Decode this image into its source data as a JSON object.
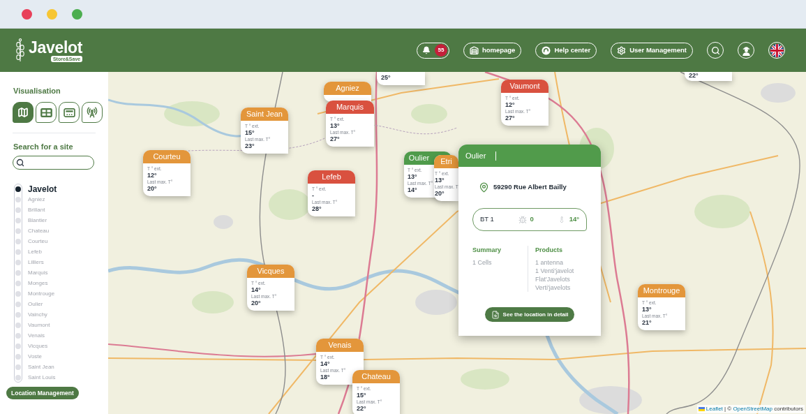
{
  "header": {
    "logo": {
      "name": "Javelot",
      "tagline": "Store&Save"
    },
    "notifications": {
      "count": "55"
    },
    "nav": [
      {
        "kind": "home",
        "label": "homepage"
      },
      {
        "kind": "help",
        "label": "Help center"
      },
      {
        "kind": "settings",
        "label": "User Management"
      }
    ],
    "tools": [
      {
        "kind": "search"
      },
      {
        "kind": "profile"
      },
      {
        "kind": "language"
      }
    ]
  },
  "sidebar": {
    "visualisation": {
      "title": "Visualisation",
      "views": [
        {
          "kind": "map",
          "selected": true
        },
        {
          "kind": "table",
          "selected": false
        },
        {
          "kind": "dashboard",
          "selected": false
        },
        {
          "kind": "antenna",
          "selected": false
        }
      ]
    },
    "search": {
      "title": "Search for a site"
    },
    "sites": [
      {
        "name": "Javelot",
        "selected": true
      },
      {
        "name": "Agniez",
        "selected": false
      },
      {
        "name": "Brillant",
        "selected": false
      },
      {
        "name": "Blantier",
        "selected": false
      },
      {
        "name": "Chateau",
        "selected": false
      },
      {
        "name": "Courteu",
        "selected": false
      },
      {
        "name": "Lefeb",
        "selected": false
      },
      {
        "name": "Lilliers",
        "selected": false
      },
      {
        "name": "Marquis",
        "selected": false
      },
      {
        "name": "Monges",
        "selected": false
      },
      {
        "name": "Montrouge",
        "selected": false
      },
      {
        "name": "Oulier",
        "selected": false
      },
      {
        "name": "Vainchy",
        "selected": false
      },
      {
        "name": "Vaumont",
        "selected": false
      },
      {
        "name": "Venais",
        "selected": false
      },
      {
        "name": "Vicques",
        "selected": false
      },
      {
        "name": "Voste",
        "selected": false
      },
      {
        "name": "Saint Jean",
        "selected": false
      },
      {
        "name": "Saint Louis",
        "selected": false
      }
    ],
    "action": "Location Management"
  },
  "map": {
    "markers": [
      {
        "max": "25°"
      },
      {
        "max": "22°"
      },
      {
        "name": "Agniez",
        "color": "#e3963b"
      },
      {
        "name": "Marquis",
        "color": "#d9513f",
        "ext_label": "T ° ext.",
        "ext": "13°",
        "max_label": "Last max. T°",
        "max": "27°"
      },
      {
        "name": "Saint Jean",
        "color": "#e3963b",
        "ext_label": "T ° ext.",
        "ext": "15°",
        "max_label": "Last max. T°",
        "max": "23°"
      },
      {
        "name": "Courteu",
        "color": "#e3963b",
        "ext_label": "T ° ext.",
        "ext": "12°",
        "max_label": "Last max. T°",
        "max": "20°"
      },
      {
        "name": "Lefeb",
        "color": "#d9513f",
        "ext_label": "T ° ext.",
        "ext": "-",
        "max_label": "Last max. T°",
        "max": "28°"
      },
      {
        "name": "Oulier",
        "color": "#4f9b4b",
        "ext_label": "T ° ext.",
        "ext": "13°",
        "max_label": "Last max. T°",
        "max": "14°"
      },
      {
        "name": "Etri",
        "color": "#e3963b",
        "ext_label": "T ° ext.",
        "ext": "13°",
        "max_label": "Last max. T",
        "max": "20°"
      },
      {
        "name": "Vaumont",
        "color": "#d9513f",
        "ext_label": "T ° ext.",
        "ext": "12°",
        "max_label": "Last max. T°",
        "max": "27°"
      },
      {
        "name": "Vicques",
        "color": "#e3963b",
        "ext_label": "T ° ext.",
        "ext": "14°",
        "max_label": "Last max. T°",
        "max": "20°"
      },
      {
        "name": "Venais",
        "color": "#e3963b",
        "ext_label": "T ° ext.",
        "ext": "14°",
        "max_label": "Last max. T°",
        "max": "18°"
      },
      {
        "name": "Chateau",
        "color": "#e3963b",
        "ext_label": "T ° ext.",
        "ext": "15°",
        "max_label": "Last max. T°",
        "max": "22°"
      },
      {
        "name": "Montrouge",
        "color": "#e3963b",
        "ext_label": "T ° ext.",
        "ext": "13°",
        "max_label": "Last max. T°",
        "max": "21°"
      }
    ],
    "popup": {
      "title": "Oulier",
      "address": "59290 Rue Albert Bailly",
      "cell": {
        "name": "BT 1",
        "insects": "0",
        "temperature": "14°"
      },
      "summary": {
        "title": "Summary",
        "items": [
          "1 Cells"
        ]
      },
      "products": {
        "title": "Products",
        "items": [
          "1 antenna",
          "1 Venti'javelot",
          "Flat'Javelots",
          "Verti'javelots"
        ]
      },
      "action": "See the location in detail"
    },
    "attribution": {
      "library": "Leaflet",
      "separator": "| ©",
      "source": "OpenStreetMap",
      "suffix": "contributors"
    }
  }
}
